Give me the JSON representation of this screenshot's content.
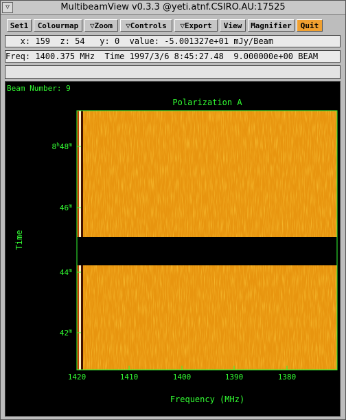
{
  "window": {
    "title": "MultibeamView v0.3.3 @yeti.atnf.CSIRO.AU:17525"
  },
  "toolbar": {
    "set1": "Set1",
    "colourmap": "Colourmap",
    "zoom": "▽Zoom",
    "controls": "▽Controls",
    "export": "▽Export",
    "view": "View",
    "magnifier": "Magnifier",
    "quit": "Quit"
  },
  "status": {
    "cursor": "   x: 159  z: 54   y: 0  value: -5.001327e+01 mJy/Beam",
    "info": "Freq: 1400.375 MHz  Time 1997/3/6 8:45:27.48  9.000000e+00 BEAM",
    "message": ""
  },
  "plot": {
    "beam_label": "Beam Number: 9",
    "title": "Polarization A",
    "ylabel": "Time",
    "xlabel": "Frequency (MHz)",
    "xticks": [
      "1420",
      "1410",
      "1400",
      "1390",
      "1380"
    ],
    "yticks": [
      {
        "big": "8",
        "sup": "h",
        "mid": "48",
        "sup2": "m"
      },
      {
        "big": "",
        "sup": "",
        "mid": "46",
        "sup2": "m"
      },
      {
        "big": "",
        "sup": "",
        "mid": "44",
        "sup2": "m"
      },
      {
        "big": "",
        "sup": "",
        "mid": "42",
        "sup2": "m"
      }
    ]
  },
  "colors": {
    "axis": "#33ff33",
    "image_base": "#e8950f",
    "gap": "#000000",
    "quit_button": "#f0a030"
  }
}
